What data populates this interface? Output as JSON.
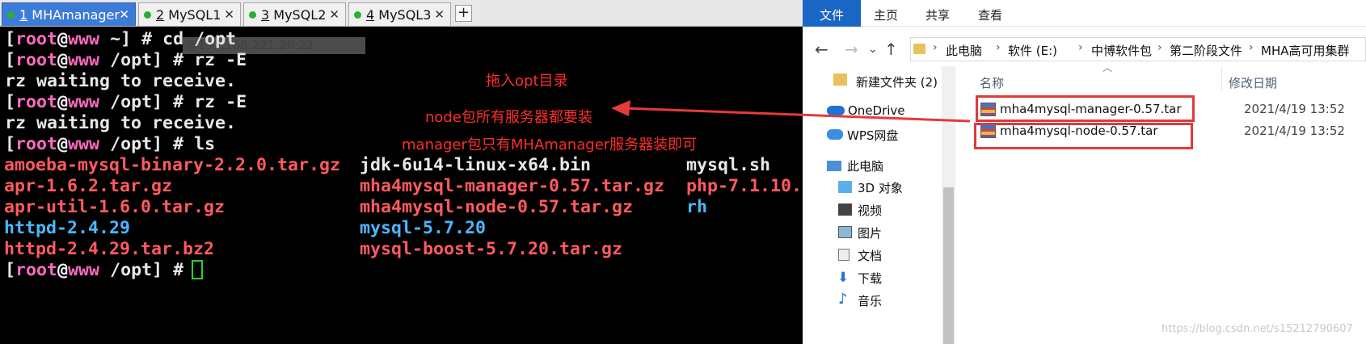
{
  "terminal": {
    "tabs": [
      {
        "num": "1",
        "name": "MHAmanager"
      },
      {
        "num": "2",
        "name": "MySQL1"
      },
      {
        "num": "3",
        "name": "MySQL2"
      },
      {
        "num": "4",
        "name": "MySQL3"
      }
    ],
    "add_tab": "+",
    "tooltip": "@192.168.221.20:22",
    "prompt_user": "root",
    "prompt_at": "@",
    "prompt_host": "www",
    "lines": {
      "l1_dir": " ~]",
      "l1_cmd": " # cd /opt",
      "l2_dir": " /opt]",
      "l2_cmd": " # rz -E",
      "l3": "rz waiting to receive.",
      "l4_cmd": " # rz -E",
      "l5": "rz waiting to receive.",
      "l6_cmd": " # ls",
      "l7_cmd": " # "
    },
    "ls_files": [
      [
        "amoeba-mysql-binary-2.2.0.tar.gz",
        "jdk-6u14-linux-x64.bin",
        "mysql.sh"
      ],
      [
        "apr-1.6.2.tar.gz",
        "mha4mysql-manager-0.57.tar.gz",
        "php-7.1.10."
      ],
      [
        "apr-util-1.6.0.tar.gz",
        "mha4mysql-node-0.57.tar.gz",
        "rh"
      ],
      [
        "httpd-2.4.29",
        "mysql-5.7.20",
        ""
      ],
      [
        "httpd-2.4.29.tar.bz2",
        "mysql-boost-5.7.20.tar.gz",
        ""
      ]
    ]
  },
  "annotations": {
    "a1": "拖入opt目录",
    "a2": "node包所有服务器都要装",
    "a3": "manager包只有MHAmanager服务器装即可"
  },
  "explorer": {
    "ribbon": [
      "文件",
      "主页",
      "共享",
      "查看"
    ],
    "breadcrumb": [
      "此电脑",
      "软件 (E:)",
      "中博软件包",
      "第二阶段文件",
      "MHA高可用集群"
    ],
    "nav_items": [
      "新建文件夹 (2)",
      "OneDrive",
      "WPS网盘",
      "此电脑",
      "3D 对象",
      "视频",
      "图片",
      "文档",
      "下载",
      "音乐"
    ],
    "columns": {
      "name": "名称",
      "date": "修改日期"
    },
    "files": [
      {
        "name": "mha4mysql-manager-0.57.tar",
        "date": "2021/4/19 13:52"
      },
      {
        "name": "mha4mysql-node-0.57.tar",
        "date": "2021/4/19 13:52"
      }
    ]
  },
  "watermark": "https://blog.csdn.net/s15212790607"
}
